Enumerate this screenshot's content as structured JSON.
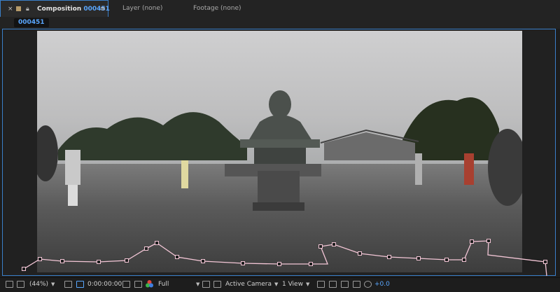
{
  "tabs": {
    "close_glyph": "×",
    "composition_label": "Composition",
    "composition_number": "000451",
    "menu_glyph": "≡",
    "layer_label": "Layer (none)",
    "footage_label": "Footage (none)"
  },
  "comp_tag": "000451",
  "footer": {
    "zoom": "(44%)",
    "timecode": "0:00:00:00",
    "resolution": "Full",
    "camera": "Active Camera",
    "view": "1 View",
    "exposure": "+0.0",
    "dropdown_glyph": "▼"
  },
  "colors": {
    "accent": "#3a7fc9",
    "highlight_text": "#5aa7ff",
    "curve": "#f3c6d6"
  },
  "icons": [
    "close-icon",
    "lock-icon",
    "panel-menu-icon",
    "always-preview-icon",
    "monitor-icon",
    "snapshot-icon",
    "color-channel-icon",
    "region-icon",
    "transparency-grid-icon",
    "layout-icon",
    "fast-preview-icon",
    "timeline-icon",
    "flowchart-icon",
    "exposure-icon"
  ]
}
